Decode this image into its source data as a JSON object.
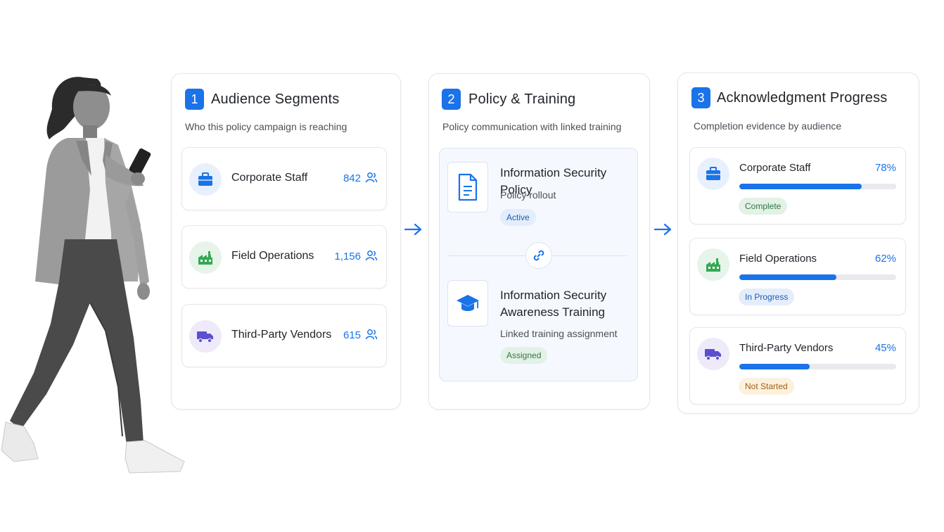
{
  "colors": {
    "accent": "#1a73e8",
    "green": "#34a853",
    "purple": "#5b4fcf",
    "pill_green_bg": "#e3f1e6",
    "pill_blue_bg": "#e3edfb",
    "pill_orange_bg": "#fcf1dc"
  },
  "audience": {
    "step": "1",
    "title": "Audience Segments",
    "subtitle": "Who this policy campaign is reaching",
    "segments": [
      {
        "icon": "briefcase-icon",
        "name": "Corporate Staff",
        "count": "842"
      },
      {
        "icon": "factory-icon",
        "name": "Field Operations",
        "count": "1,156"
      },
      {
        "icon": "truck-icon",
        "name": "Third-Party Vendors",
        "count": "615"
      }
    ]
  },
  "policy": {
    "step": "2",
    "title": "Policy & Training",
    "subtitle": "Policy communication with linked training",
    "policy_item": {
      "icon": "document-icon",
      "title": "Information Security Policy",
      "subtitle": "Policy rollout",
      "status": "Active"
    },
    "link_icon": "link-icon",
    "training_item": {
      "icon": "graduation-cap-icon",
      "title_line1": "Information Security",
      "title_line2": "Awareness Training",
      "subtitle": "Linked training assignment",
      "status": "Assigned"
    }
  },
  "progress": {
    "step": "3",
    "title": "Acknowledgment Progress",
    "subtitle": "Completion evidence by audience",
    "rows": [
      {
        "icon": "briefcase-icon",
        "name": "Corporate Staff",
        "percent_label": "78%",
        "percent": 78,
        "status": "Complete"
      },
      {
        "icon": "factory-icon",
        "name": "Field Operations",
        "percent_label": "62%",
        "percent": 62,
        "status": "In Progress"
      },
      {
        "icon": "truck-icon",
        "name": "Third-Party Vendors",
        "percent_label": "45%",
        "percent": 45,
        "status": "Not Started"
      }
    ]
  }
}
